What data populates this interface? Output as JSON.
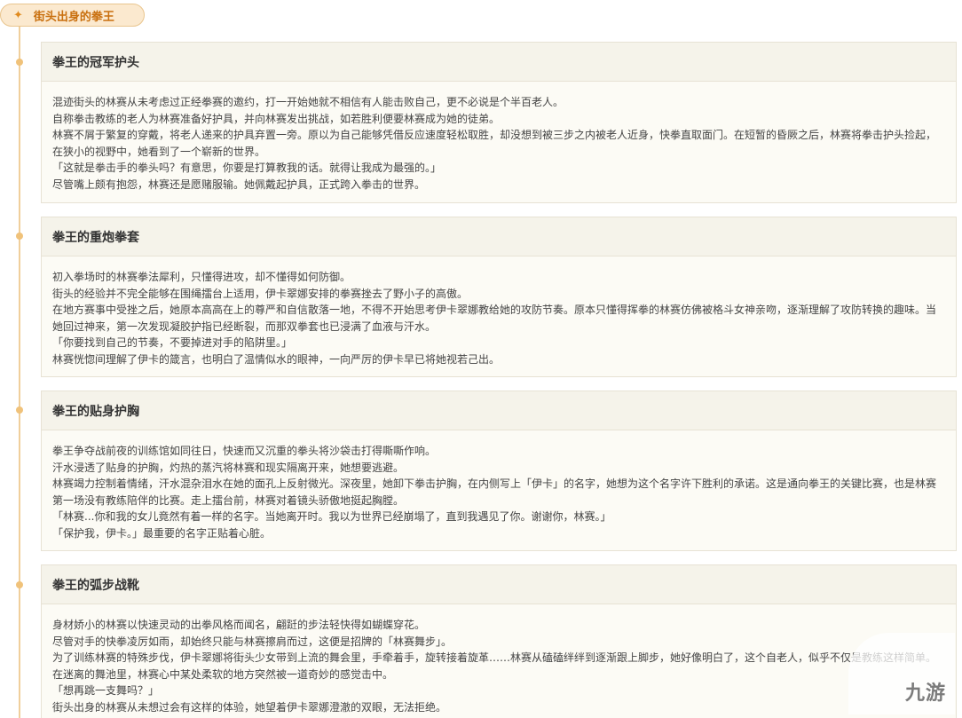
{
  "header": {
    "icon": "sparkle-icon",
    "title": "街头出身的拳王"
  },
  "cards": [
    {
      "title": "拳王的冠军护头",
      "lines": [
        "混迹街头的林赛从未考虑过正经拳赛的邀约，打一开始她就不相信有人能击败自己，更不必说是个半百老人。",
        "自称拳击教练的老人为林赛准备好护具，并向林赛发出挑战，如若胜利便要林赛成为她的徒弟。",
        "林赛不屑于繁复的穿戴，将老人递来的护具弃置一旁。原以为自己能够凭借反应速度轻松取胜，却没想到被三步之内被老人近身，快拳直取面门。在短暂的昏厥之后，林赛将拳击护头捡起，在狭小的视野中，她看到了一个崭新的世界。",
        "「这就是拳击手的拳头吗？有意思，你要是打算教我的话。就得让我成为最强的。」",
        "尽管嘴上颇有抱怨，林赛还是愿赌服输。她佩戴起护具，正式跨入拳击的世界。"
      ]
    },
    {
      "title": "拳王的重炮拳套",
      "lines": [
        "初入拳场时的林赛拳法犀利，只懂得进攻，却不懂得如何防御。",
        "街头的经验并不完全能够在围绳擂台上适用，伊卡翠娜安排的拳赛挫去了野小子的高傲。",
        "在地方赛事中受挫之后，她原本高高在上的尊严和自信散落一地，不得不开始思考伊卡翠娜教给她的攻防节奏。原本只懂得挥拳的林赛仿佛被格斗女神亲吻，逐渐理解了攻防转换的趣味。当她回过神来，第一次发现凝胶护指已经断裂，而那双拳套也已浸满了血液与汗水。",
        "「你要找到自己的节奏，不要掉进对手的陷阱里。」",
        "林赛恍惚间理解了伊卡的箴言，也明白了温情似水的眼神，一向严厉的伊卡早已将她视若己出。"
      ]
    },
    {
      "title": "拳王的贴身护胸",
      "lines": [
        "拳王争夺战前夜的训练馆如同往日，快速而又沉重的拳头将沙袋击打得嘶嘶作响。",
        "汗水浸透了贴身的护胸，灼热的蒸汽将林赛和现实隔离开来，她想要逃避。",
        "林赛竭力控制着情绪，汗水混杂泪水在她的面孔上反射微光。深夜里，她卸下拳击护胸，在内侧写上「伊卡」的名字，她想为这个名字许下胜利的承诺。这是通向拳王的关键比赛，也是林赛第一场没有教练陪伴的比赛。走上擂台前，林赛对着镜头骄傲地挺起胸膛。",
        "「林赛...你和我的女儿竟然有着一样的名字。当她离开时。我以为世界已经崩塌了，直到我遇见了你。谢谢你，林赛。」",
        "「保护我，伊卡。」最重要的名字正贴着心脏。"
      ]
    },
    {
      "title": "拳王的弧步战靴",
      "lines": [
        "身材娇小的林赛以快速灵动的出拳风格而闻名，翩跹的步法轻快得如蝴蝶穿花。",
        "尽管对手的快拳凌厉如雨，却始终只能与林赛擦肩而过，这便是招牌的「林赛舞步」。",
        "为了训练林赛的特殊步伐，伊卡翠娜将街头少女带到上流的舞会里，手牵着手，旋转接着旋革……林赛从磕磕绊绊到逐渐跟上脚步，她好像明白了，这个自老人，似乎不仅是教练这样简单。在迷离的舞池里，林赛心中某处柔软的地方突然被一道奇妙的感觉击中。",
        "「想再跳一支舞吗？」",
        "街头出身的林赛从未想过会有这样的体验，她望着伊卡翠娜澄澈的双眼，无法拒绝。"
      ]
    }
  ],
  "watermark": {
    "text": "九游",
    "icon": "jiuyou-logo-icon"
  }
}
